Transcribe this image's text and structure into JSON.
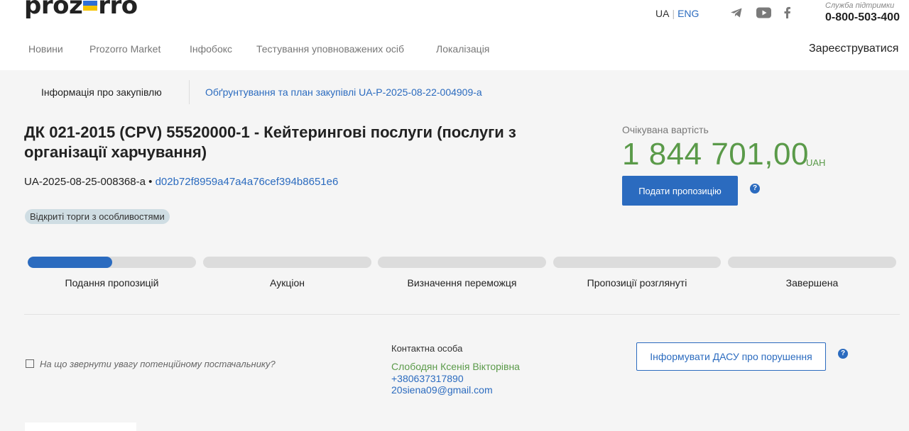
{
  "header": {
    "logo_left": "proz",
    "logo_right": "rro",
    "lang_ua": "UA",
    "lang_sep": "|",
    "lang_eng": "ENG",
    "support_label": "Служба підтримки",
    "support_phone": "0-800-503-400",
    "social_icons": [
      "telegram-icon",
      "youtube-icon",
      "facebook-icon"
    ]
  },
  "nav": {
    "items": [
      "Новини",
      "Prozorro Market",
      "Інфобокс",
      "Тестування уповноважених осіб",
      "Локалізація"
    ],
    "register": "Зареєструватися"
  },
  "tabs": {
    "info": "Інформація про закупівлю",
    "plan": "Обґрунтування та план закупівлі UA-P-2025-08-22-004909-a"
  },
  "tender": {
    "title": "ДК 021-2015 (CPV) 55520000-1 - Кейтерингові послуги (послуги з організації харчування)",
    "id": "UA-2025-08-25-008368-a",
    "dot": "•",
    "hash": "d02b72f8959a47a4a76cef394b8651e6",
    "procedure": "Відкриті торги з особливостями",
    "expected_label": "Очікувана вартість",
    "expected_value": "1 844 701,00",
    "currency": "UAH",
    "submit_label": "Подати пропозицію"
  },
  "stages": {
    "items": [
      {
        "label": "Подання пропозицій",
        "progress": 0.5
      },
      {
        "label": "Аукціон",
        "progress": 0
      },
      {
        "label": "Визначення переможця",
        "progress": 0
      },
      {
        "label": "Пропозиції розглянуті",
        "progress": 0
      },
      {
        "label": "Завершена",
        "progress": 0
      }
    ]
  },
  "footer": {
    "hint": "На що звернути увагу потенційному постачальнику?",
    "contact_label": "Контактна особа",
    "contact_name": "Слободян Ксенія Вікторівна",
    "contact_phone": "+380637317890",
    "contact_email": "20siena09@gmail.com",
    "dasu_label": "Інформувати ДАСУ про порушення"
  },
  "colors": {
    "accent": "#2b6bbf",
    "price": "#5a9a49",
    "flag_blue": "#2f6fd6",
    "flag_yellow": "#f5c400"
  }
}
